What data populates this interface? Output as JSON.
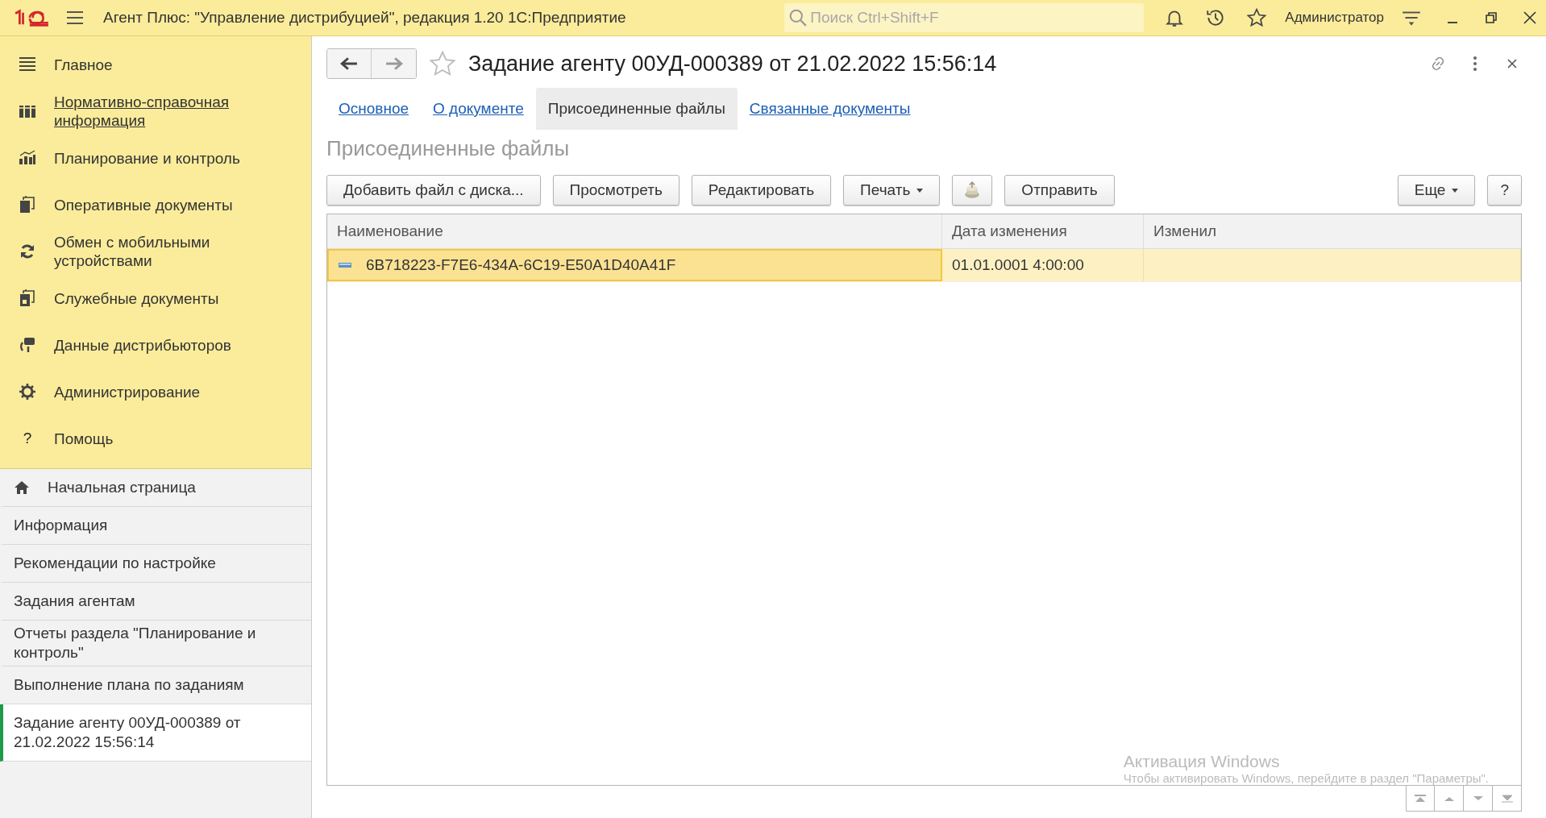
{
  "app_bar": {
    "title": "Агент Плюс: \"Управление дистрибуцией\", редакция 1.20 1С:Предприятие",
    "search": {
      "placeholder": "Поиск Ctrl+Shift+F"
    },
    "user": "Администратор"
  },
  "sections": [
    {
      "label": "Главное",
      "hovered": false
    },
    {
      "label": "Нормативно-справочная информация",
      "hovered": true
    },
    {
      "label": "Планирование и контроль",
      "hovered": false
    },
    {
      "label": "Оперативные документы",
      "hovered": false
    },
    {
      "label": "Обмен с мобильными устройствами",
      "hovered": false
    },
    {
      "label": "Служебные документы",
      "hovered": false
    },
    {
      "label": "Данные дистрибьюторов",
      "hovered": false
    },
    {
      "label": "Администрирование",
      "hovered": false
    },
    {
      "label": "Помощь",
      "hovered": false,
      "glyph": "?"
    }
  ],
  "open_pages": [
    {
      "label": "Начальная страница",
      "kind": "home",
      "selected": false
    },
    {
      "label": "Информация",
      "kind": "page",
      "selected": false
    },
    {
      "label": "Рекомендации по настройке",
      "kind": "page",
      "selected": false
    },
    {
      "label": "Задания агентам",
      "kind": "page",
      "selected": false
    },
    {
      "label": "Отчеты раздела \"Планирование и контроль\"",
      "kind": "page",
      "selected": false
    },
    {
      "label": "Выполнение плана по заданиям",
      "kind": "page",
      "selected": false
    },
    {
      "label": "Задание агенту 00УД-000389 от 21.02.2022 15:56:14",
      "kind": "page",
      "selected": true
    }
  ],
  "document": {
    "title": "Задание агенту 00УД-000389 от 21.02.2022 15:56:14",
    "favorite": false,
    "tabs": [
      {
        "label": "Основное",
        "selected": false
      },
      {
        "label": "О документе",
        "selected": false
      },
      {
        "label": "Присоединенные файлы",
        "selected": true
      },
      {
        "label": "Связанные документы",
        "selected": false
      }
    ],
    "heading": "Присоединенные файлы",
    "toolbar_left": [
      {
        "kind": "text",
        "label": "Добавить файл с диска..."
      },
      {
        "kind": "text",
        "label": "Просмотреть"
      },
      {
        "kind": "text",
        "label": "Редактировать"
      },
      {
        "kind": "dropdown",
        "label": "Печать"
      },
      {
        "kind": "icon"
      },
      {
        "kind": "text",
        "label": "Отправить"
      }
    ],
    "toolbar_right": [
      {
        "kind": "dropdown",
        "label": "Еще"
      },
      {
        "kind": "text",
        "label": "?"
      }
    ],
    "table": {
      "columns": [
        "Наименование",
        "Дата изменения",
        "Изменил"
      ],
      "rows": [
        {
          "selected": true,
          "cells": [
            {
              "text": "6B718223-F7E6-434A-6C19-E50A1D40A41F",
              "focused": true
            },
            {
              "text": "01.01.0001 4:00:00",
              "focused": false
            },
            {
              "text": "",
              "focused": false
            }
          ]
        }
      ]
    }
  },
  "os_notice": {
    "title": "Активация Windows",
    "text": "Чтобы активировать Windows, перейдите в раздел \"Параметры\"."
  }
}
